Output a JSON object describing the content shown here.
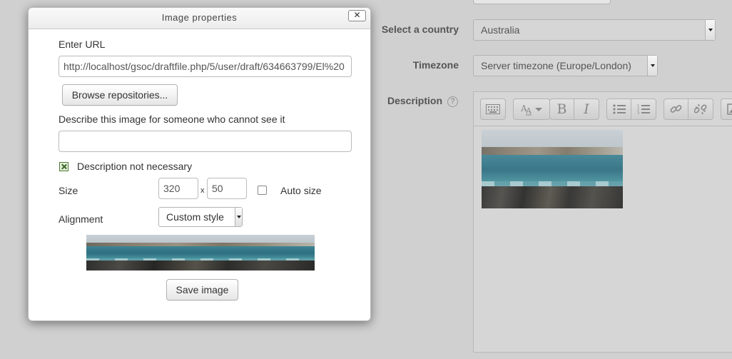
{
  "background_form": {
    "country": {
      "label": "Select a country",
      "value": "Australia"
    },
    "timezone": {
      "label": "Timezone",
      "value": "Server timezone (Europe/London)"
    },
    "description": {
      "label": "Description",
      "help_glyph": "?"
    },
    "toolbar": {
      "icons": [
        "keyboard-icon",
        "font-style-icon",
        "bold-icon",
        "italic-icon",
        "unordered-list-icon",
        "ordered-list-icon",
        "link-icon",
        "unlink-icon",
        "image-icon"
      ],
      "bold_glyph": "B",
      "italic_glyph": "I"
    }
  },
  "dialog": {
    "title": "Image properties",
    "close_glyph": "✕",
    "url": {
      "label": "Enter URL",
      "value": "http://localhost/gsoc/draftfile.php/5/user/draft/634663799/El%20"
    },
    "browse_button": "Browse repositories...",
    "alt": {
      "label": "Describe this image for someone who cannot see it",
      "value": ""
    },
    "description_not_necessary": {
      "label": "Description not necessary",
      "checked": true
    },
    "size": {
      "label": "Size",
      "width": "320",
      "separator": "x",
      "height": "50",
      "auto_size_label": "Auto size",
      "auto_size_checked": false
    },
    "alignment": {
      "label": "Alignment",
      "value": "Custom style"
    },
    "save_button": "Save image"
  },
  "colors": {
    "page_background": "#d0d0d0",
    "dialog_background": "#ffffff",
    "checkbox_green": "#4e7a35"
  }
}
